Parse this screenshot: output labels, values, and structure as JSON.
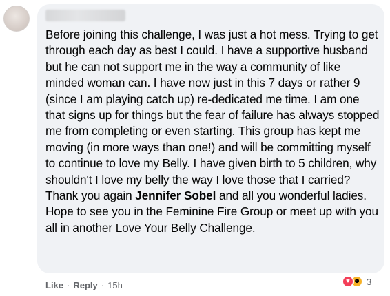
{
  "comment": {
    "body_before_mention": "Before joining this challenge, I was just a hot mess. Trying to get through each day as best I could. I have a supportive husband but he can not support me in the way a community of like minded woman can. I have now just in this 7 days or rather 9 (since I am playing catch up) re-dedicated me time. I am one that signs up for things but the fear of failure has always stopped me from completing or even starting. This group has kept me moving (in more ways than one!) and will be committing myself to continue to love my Belly. I have given birth to 5 children, why shouldn't I love my belly the way I love those that I carried? Thank you again ",
    "mention": "Jennifer Sobel",
    "body_after_mention": " and all you wonderful ladies. Hope to see you in the Feminine Fire Group or meet up with you all in another Love Your Belly Challenge."
  },
  "actions": {
    "like_label": "Like",
    "separator": "·",
    "reply_label": "Reply",
    "timestamp": "15h"
  },
  "reactions": {
    "count": "3",
    "icons": [
      "love-reaction-icon",
      "care-reaction-icon"
    ],
    "love_color": "#f33e58",
    "care_color": "#f7b125"
  },
  "colors": {
    "bubble": "#f0f2f5",
    "text": "#050505",
    "secondary_text": "#65676b"
  }
}
